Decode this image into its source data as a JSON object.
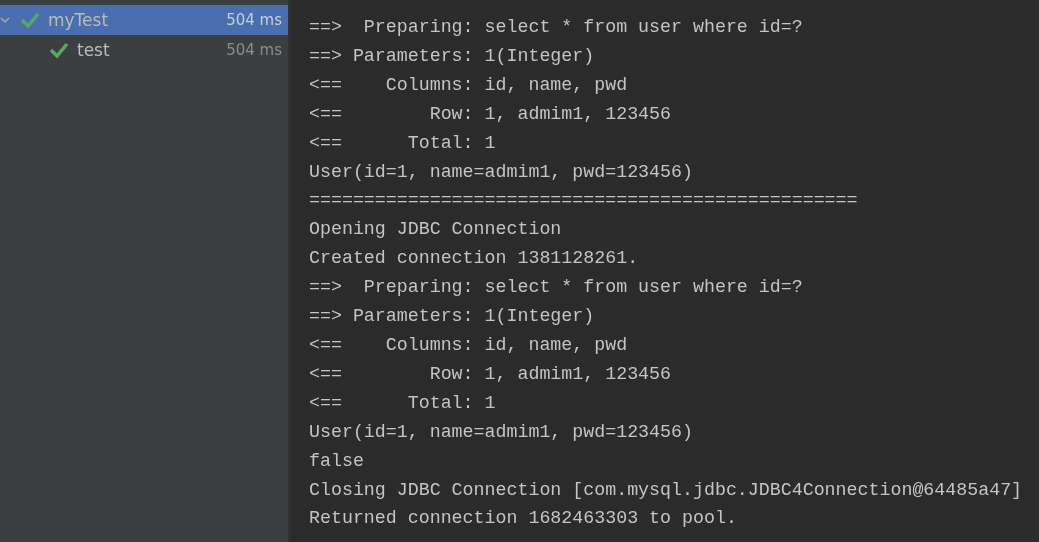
{
  "test_tree": [
    {
      "name": "myTest",
      "time": "504 ms",
      "passed": true,
      "selected": true,
      "expanded": true,
      "children": [
        {
          "name": "test",
          "time": "504 ms",
          "passed": true,
          "selected": false
        }
      ]
    }
  ],
  "console": {
    "lines": [
      "==>  Preparing: select * from user where id=?",
      "==> Parameters: 1(Integer)",
      "<==    Columns: id, name, pwd",
      "<==        Row: 1, admim1, 123456",
      "<==      Total: 1",
      "User(id=1, name=admim1, pwd=123456)",
      "==================================================",
      "Opening JDBC Connection",
      "Created connection 1381128261.",
      "==>  Preparing: select * from user where id=?",
      "==> Parameters: 1(Integer)",
      "<==    Columns: id, name, pwd",
      "<==        Row: 1, admim1, 123456",
      "<==      Total: 1",
      "User(id=1, name=admim1, pwd=123456)",
      "false",
      "Closing JDBC Connection [com.mysql.jdbc.JDBC4Connection@64485a47]",
      "Returned connection 1682463303 to pool."
    ]
  }
}
